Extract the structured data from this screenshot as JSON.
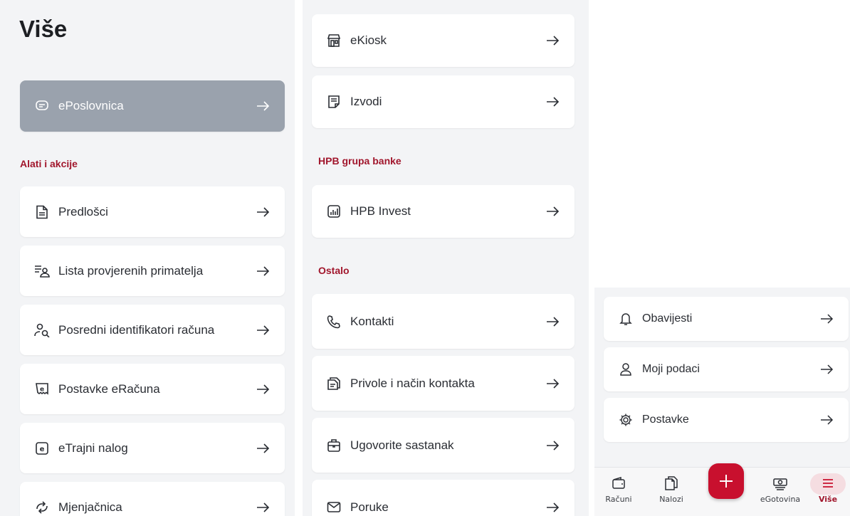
{
  "colors": {
    "accent": "#a1162c",
    "fab": "#c8102e",
    "highlight": "#9aa2ad",
    "panel_bg": "#f3f4f6"
  },
  "screen1": {
    "title": "Više",
    "highlight_item": {
      "label": "ePoslovnica",
      "icon": "chat-bubble-icon"
    },
    "section_tools": "Alati i akcije",
    "items": [
      {
        "label": "Predlošci",
        "icon": "document-icon"
      },
      {
        "label": "Lista provjerenih primatelja",
        "icon": "list-person-icon"
      },
      {
        "label": "Posredni identifikatori računa",
        "icon": "person-search-icon"
      },
      {
        "label": "Postavke eRačuna",
        "icon": "e-receipt-icon"
      },
      {
        "label": "eTrajni nalog",
        "icon": "e-square-icon"
      },
      {
        "label": "Mjenjačnica",
        "icon": "exchange-icon"
      }
    ]
  },
  "screen2": {
    "top_items": [
      {
        "label": "eKiosk",
        "icon": "kiosk-icon"
      },
      {
        "label": "Izvodi",
        "icon": "statement-icon"
      }
    ],
    "section_group": "HPB grupa banke",
    "group_items": [
      {
        "label": "HPB Invest",
        "icon": "chart-icon"
      }
    ],
    "section_other": "Ostalo",
    "other_items": [
      {
        "label": "Kontakti",
        "icon": "phone-icon"
      },
      {
        "label": "Privole i način kontakta",
        "icon": "consent-icon"
      },
      {
        "label": "Ugovorite sastanak",
        "icon": "briefcase-icon"
      },
      {
        "label": "Poruke",
        "icon": "mail-icon"
      }
    ]
  },
  "screen3": {
    "items": [
      {
        "label": "Obavijesti",
        "icon": "bell-icon"
      },
      {
        "label": "Moji podaci",
        "icon": "person-icon"
      },
      {
        "label": "Postavke",
        "icon": "gear-icon"
      }
    ],
    "nav": [
      {
        "label": "Računi",
        "icon": "wallet-icon"
      },
      {
        "label": "Nalozi",
        "icon": "orders-icon"
      },
      {
        "label": "eGotovina",
        "icon": "cash-icon"
      },
      {
        "label": "Više",
        "icon": "menu-icon"
      }
    ],
    "fab_icon": "plus-icon"
  }
}
